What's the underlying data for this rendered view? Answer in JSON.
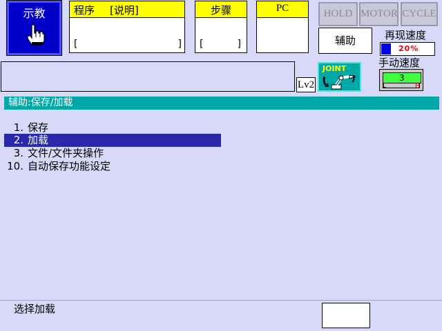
{
  "mode": {
    "label": "示教",
    "icon": "hand-pointer-icon"
  },
  "header": {
    "program": {
      "title": "程序",
      "desc": "[说明]",
      "bracket_open": "[",
      "bracket_close": "]"
    },
    "step": {
      "title": "步骤",
      "bracket_open": "[",
      "bracket_close": "]"
    },
    "pc": {
      "title": "PC"
    }
  },
  "status": {
    "hold": "HOLD",
    "motor": "MOTOR",
    "cycle": "CYCLE"
  },
  "aux_button": "辅助",
  "replay_speed": {
    "label": "再现速度",
    "value": "20%",
    "percent": 20
  },
  "manual_speed": {
    "label": "手动速度",
    "value": "3",
    "low": "L",
    "high": "H"
  },
  "level": "Lv2",
  "joint": {
    "label": "JOINT",
    "icon": "robot-arm-icon"
  },
  "title": "辅助:保存/加载",
  "menu": [
    {
      "num": "1.",
      "label": "保存",
      "selected": false
    },
    {
      "num": "2.",
      "label": "加载",
      "selected": true
    },
    {
      "num": "3.",
      "label": "文件/文件夹操作",
      "selected": false
    },
    {
      "num": "10.",
      "label": "自动保存功能设定",
      "selected": false
    }
  ],
  "prompt": "选择加载",
  "colors": {
    "accent": "#00a8a8",
    "mode_blue": "#0000c8",
    "selection": "#2828a8",
    "header_yellow": "#ffff00",
    "background": "#d8d8f8"
  }
}
